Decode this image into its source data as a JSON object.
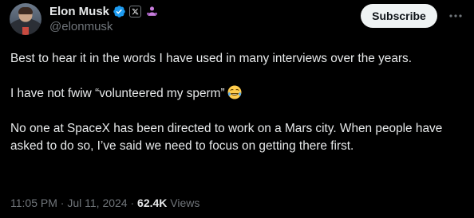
{
  "post": {
    "author": {
      "display_name": "Elon Musk",
      "handle": "@elonmusk",
      "verified_icon": "verified-badge-icon",
      "affiliation_icon": "x-logo-icon",
      "extra_icon": "people-icon"
    },
    "subscribe_label": "Subscribe",
    "more_icon": "more-horizontal-icon",
    "paragraphs": [
      "Best to hear it in the words I have used in many interviews over the years.",
      "I have not fwiw “volunteered my sperm”",
      "No one at SpaceX has been directed to work on a Mars city. When people have asked to do so, I’ve said we need to focus on getting there first."
    ],
    "emoji": "tears-of-joy-emoji",
    "time": "11:05 PM",
    "separator": "·",
    "date": "Jul 11, 2024",
    "views_count": "62.4K",
    "views_label": "Views"
  },
  "colors": {
    "background": "#000000",
    "text_primary": "#e7e9ea",
    "text_secondary": "#71767b",
    "verified_blue": "#1d9bf0",
    "button_bg": "#eff3f4",
    "button_text": "#0f1419"
  }
}
